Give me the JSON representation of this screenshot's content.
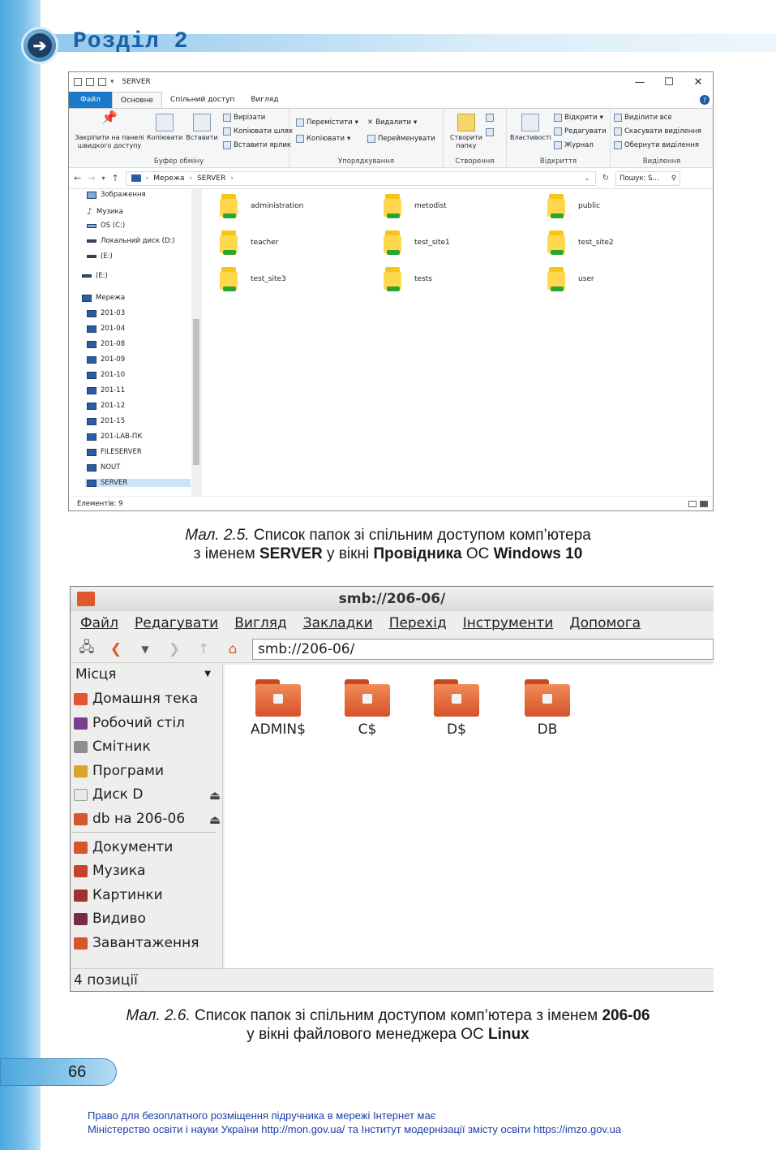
{
  "page": {
    "chapter_title": "Розділ 2",
    "page_number": "66",
    "footer_line1": "Право для безоплатного розміщення підручника в мережі Інтернет має",
    "footer_line2": "Міністерство освіти і науки України http://mon.gov.ua/ та Інститут модернізації змісту освіти https://imzo.gov.ua"
  },
  "windows_explorer": {
    "title": "SERVER",
    "tabs": [
      "Файл",
      "Основне",
      "Спільний доступ",
      "Вигляд"
    ],
    "ribbon": {
      "pin": "Закріпити на панелі швидкого доступу",
      "copy": "Копіювати",
      "paste": "Вставити",
      "cut": "Вирізати",
      "copy_path": "Копіювати шлях",
      "paste_shortcut": "Вставити ярлик",
      "clipboard_group": "Буфер обміну",
      "move_to": "Перемістити",
      "copy_to": "Копіювати",
      "delete": "Видалити",
      "rename": "Перейменувати",
      "organize_group": "Упорядкування",
      "new_folder": "Створити папку",
      "create_group": "Створення",
      "properties": "Властивості",
      "open": "Відкрити",
      "edit": "Редагувати",
      "history": "Журнал",
      "open_group": "Відкриття",
      "select_all": "Виділити все",
      "select_none": "Скасувати виділення",
      "invert_selection": "Обернути виділення",
      "select_group": "Виділення"
    },
    "address": [
      "Мережа",
      "SERVER"
    ],
    "search_placeholder": "Пошук: S...",
    "nav_items": [
      {
        "label": "Зображення",
        "icon": "pictures-icon"
      },
      {
        "label": "Музика",
        "icon": "music-icon"
      },
      {
        "label": "OS (C:)",
        "icon": "drive-icon"
      },
      {
        "label": "Локальний диск (D:)",
        "icon": "drive-icon"
      },
      {
        "label": "(E:)",
        "icon": "drive-icon"
      },
      {
        "label": "(E:)",
        "icon": "drive-icon"
      },
      {
        "label": "Мережа",
        "icon": "network-icon"
      },
      {
        "label": "201-03",
        "icon": "computer-icon"
      },
      {
        "label": "201-04",
        "icon": "computer-icon"
      },
      {
        "label": "201-08",
        "icon": "computer-icon"
      },
      {
        "label": "201-09",
        "icon": "computer-icon"
      },
      {
        "label": "201-10",
        "icon": "computer-icon"
      },
      {
        "label": "201-11",
        "icon": "computer-icon"
      },
      {
        "label": "201-12",
        "icon": "computer-icon"
      },
      {
        "label": "201-15",
        "icon": "computer-icon"
      },
      {
        "label": "201-LAB-ПК",
        "icon": "computer-icon"
      },
      {
        "label": "FILESERVER",
        "icon": "computer-icon"
      },
      {
        "label": "NOUT",
        "icon": "computer-icon"
      },
      {
        "label": "SERVER",
        "icon": "computer-icon"
      }
    ],
    "folders": [
      "administration",
      "metodist",
      "public",
      "teacher",
      "test_site1",
      "test_site2",
      "test_site3",
      "tests",
      "user"
    ],
    "status": "Елементів: 9"
  },
  "caption1": {
    "prefix": "Мал. 2.5.",
    "text1": " Список папок зі спільним доступом комп’ютера",
    "text2a": "з іменем ",
    "bold1": "SERVER",
    "text2b": " у вікні ",
    "bold2": "Провідника",
    "text2c": " ОС ",
    "bold3": "Windows 10"
  },
  "linux_fm": {
    "title": "smb://206-06/",
    "menu": [
      "Файл",
      "Редагувати",
      "Вигляд",
      "Закладки",
      "Перехід",
      "Інструменти",
      "Допомога"
    ],
    "location": "smb://206-06/",
    "places_header": "Місця",
    "places": [
      {
        "label": "Домашня тека",
        "icon": "home-icon",
        "color": "#e4572e"
      },
      {
        "label": "Робочий стіл",
        "icon": "desktop-icon",
        "color": "#7b3f8c"
      },
      {
        "label": "Смітник",
        "icon": "trash-icon",
        "color": "#8e8e8e"
      },
      {
        "label": "Програми",
        "icon": "applications-icon",
        "color": "#d9a427"
      },
      {
        "label": "Диск D",
        "icon": "drive-icon",
        "color": "#cfcfcf"
      },
      {
        "label": "db на 206-06",
        "icon": "network-share-icon",
        "color": "#d4572a"
      },
      {
        "label": "Документи",
        "icon": "documents-icon",
        "color": "#d4572a"
      },
      {
        "label": "Музика",
        "icon": "music-icon",
        "color": "#c5412a"
      },
      {
        "label": "Картинки",
        "icon": "pictures-icon",
        "color": "#a3322a"
      },
      {
        "label": "Видиво",
        "icon": "video-icon",
        "color": "#7b2a44"
      },
      {
        "label": "Завантаження",
        "icon": "downloads-icon",
        "color": "#d4572a"
      }
    ],
    "shares": [
      "ADMIN$",
      "C$",
      "D$",
      "DB"
    ],
    "status": "4 позиції"
  },
  "caption2": {
    "prefix": "Мал. 2.6.",
    "text1": " Список папок зі спільним доступом комп’ютера з іменем ",
    "bold1": "206-06",
    "text2a": "у вікні файлового менеджера ОС ",
    "bold2": "Linux"
  }
}
